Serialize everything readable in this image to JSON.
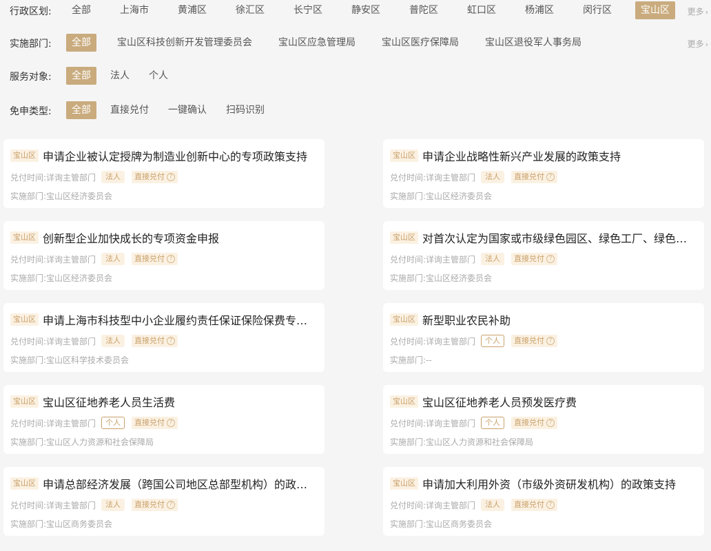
{
  "filters": {
    "more_label": "更多",
    "district": {
      "label": "行政区划:",
      "options": [
        "全部",
        "上海市",
        "黄浦区",
        "徐汇区",
        "长宁区",
        "静安区",
        "普陀区",
        "虹口区",
        "杨浦区",
        "闵行区",
        "宝山区"
      ],
      "selected": "宝山区"
    },
    "department": {
      "label": "实施部门:",
      "options": [
        "全部",
        "宝山区科技创新开发管理委员会",
        "宝山区应急管理局",
        "宝山区医疗保障局",
        "宝山区退役军人事务局"
      ],
      "selected": "全部"
    },
    "target": {
      "label": "服务对象:",
      "options": [
        "全部",
        "法人",
        "个人"
      ],
      "selected": "全部"
    },
    "type": {
      "label": "免申类型:",
      "options": [
        "全部",
        "直接兑付",
        "一键确认",
        "扫码识别"
      ],
      "selected": "全部"
    }
  },
  "card_labels": {
    "time_label": "兑付时间:",
    "dept_label": "实施部门:"
  },
  "cards": [
    {
      "district": "宝山区",
      "title": "申请企业被认定授牌为制造业创新中心的专项政策支持",
      "time": "详询主管部门",
      "target": "法人",
      "type": "直接兑付",
      "dept": "宝山区经济委员会"
    },
    {
      "district": "宝山区",
      "title": "申请企业战略性新兴产业发展的政策支持",
      "time": "详询主管部门",
      "target": "法人",
      "type": "直接兑付",
      "dept": "宝山区经济委员会"
    },
    {
      "district": "宝山区",
      "title": "创新型企业加快成长的专项资金申报",
      "time": "详询主管部门",
      "target": "法人",
      "type": "直接兑付",
      "dept": "宝山区经济委员会"
    },
    {
      "district": "宝山区",
      "title": "对首次认定为国家或市级绿色园区、绿色工厂、绿色…",
      "time": "详询主管部门",
      "target": "法人",
      "type": "直接兑付",
      "dept": "宝山区经济委员会"
    },
    {
      "district": "宝山区",
      "title": "申请上海市科技型中小企业履约责任保证保险保费专…",
      "time": "详询主管部门",
      "target": "法人",
      "type": "直接兑付",
      "dept": "宝山区科学技术委员会"
    },
    {
      "district": "宝山区",
      "title": "新型职业农民补助",
      "time": "详询主管部门",
      "target": "个人",
      "type": "直接兑付",
      "dept": "--"
    },
    {
      "district": "宝山区",
      "title": "宝山区征地养老人员生活费",
      "time": "详询主管部门",
      "target": "个人",
      "type": "直接兑付",
      "dept": "宝山区人力资源和社会保障局"
    },
    {
      "district": "宝山区",
      "title": "宝山区征地养老人员预发医疗费",
      "time": "详询主管部门",
      "target": "个人",
      "type": "直接兑付",
      "dept": "宝山区人力资源和社会保障局"
    },
    {
      "district": "宝山区",
      "title": "申请总部经济发展（跨国公司地区总部型机构）的政…",
      "time": "详询主管部门",
      "target": "法人",
      "type": "直接兑付",
      "dept": "宝山区商务委员会"
    },
    {
      "district": "宝山区",
      "title": "申请加大利用外资（市级外资研发机构）的政策支持",
      "time": "详询主管部门",
      "target": "法人",
      "type": "直接兑付",
      "dept": "宝山区商务委员会"
    }
  ],
  "colors": {
    "accent": "#c9ab7d",
    "tag_bg": "#fbf1e2",
    "tag_text": "#c9a06a",
    "page_bg": "#f5f5f5"
  }
}
